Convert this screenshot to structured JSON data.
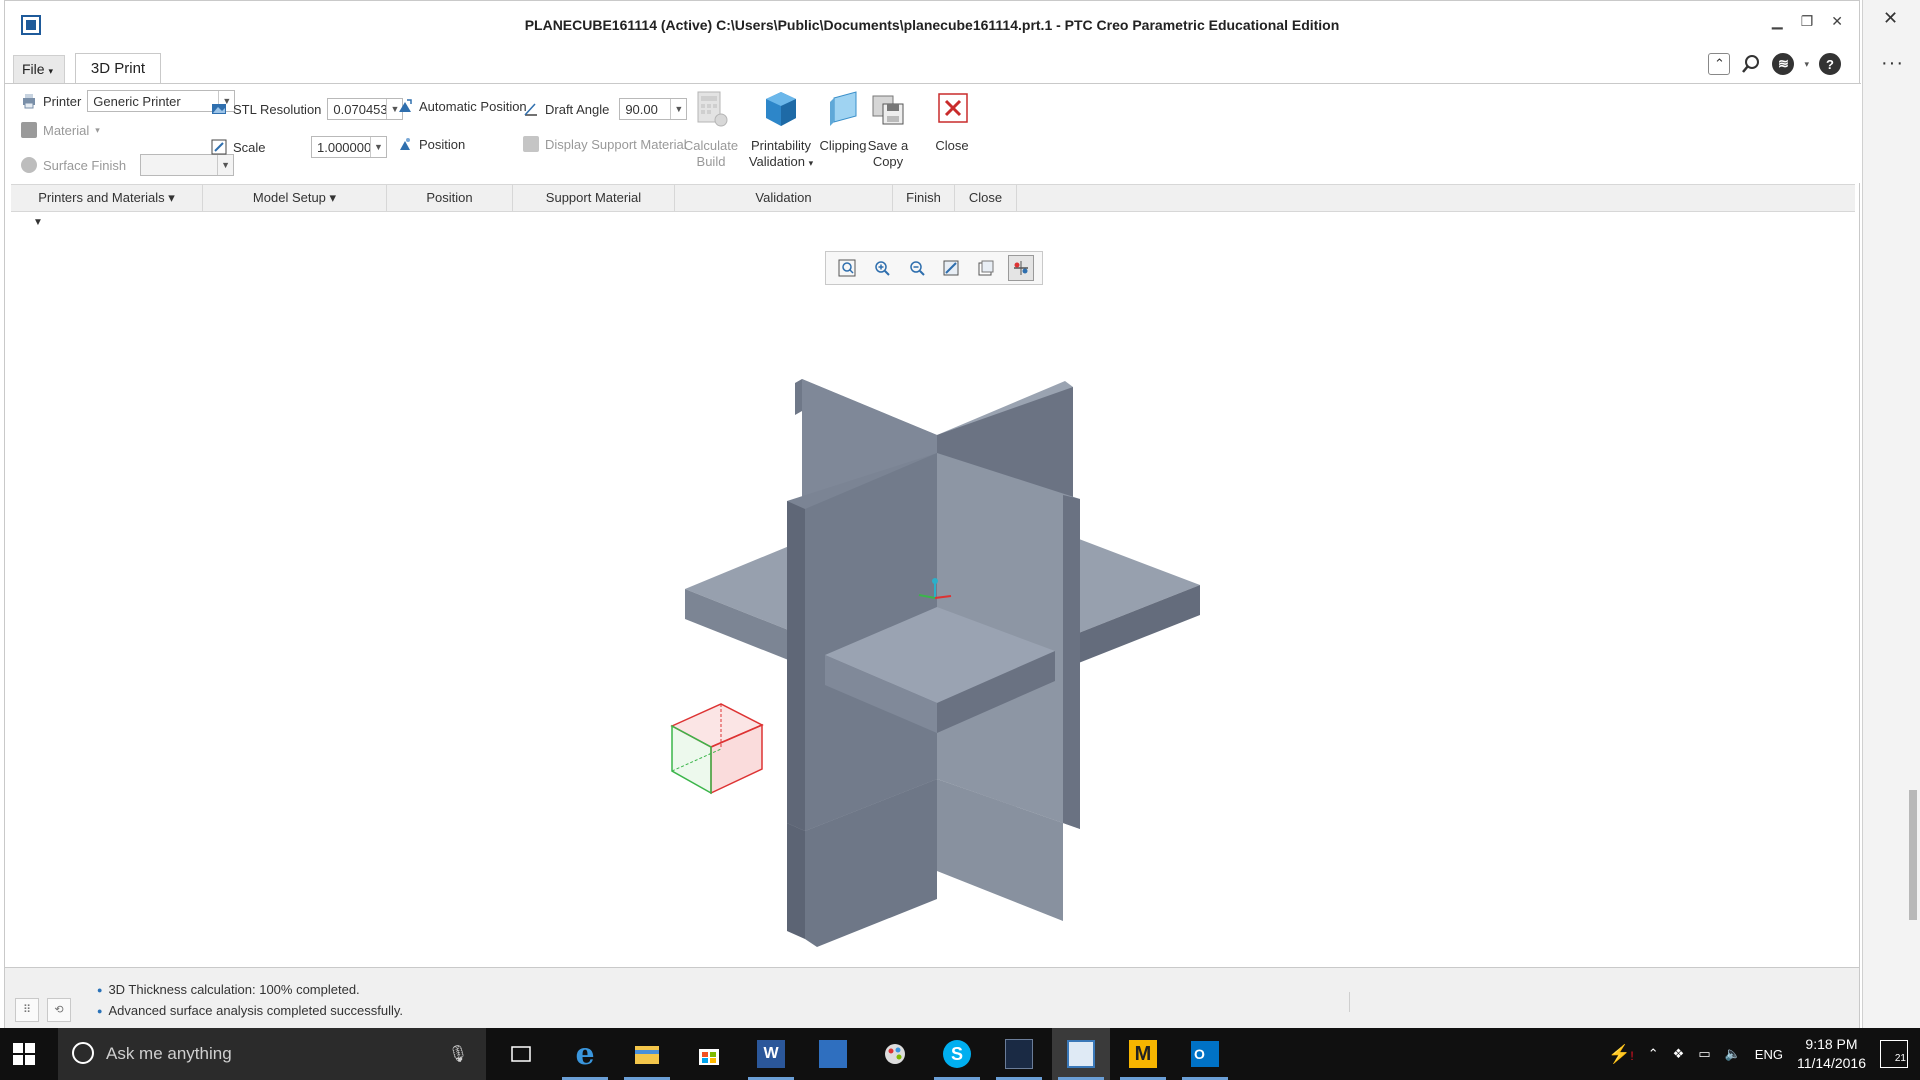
{
  "window": {
    "title": "PLANECUBE161114 (Active) C:\\Users\\Public\\Documents\\planecube161114.prt.1 - PTC Creo Parametric Educational Edition"
  },
  "tabs": {
    "file": "File",
    "active": "3D Print"
  },
  "ribbon": {
    "printer_label": "Printer",
    "printer_value": "Generic Printer",
    "material_label": "Material",
    "surface_finish_label": "Surface Finish",
    "stl_label": "STL Resolution",
    "stl_value": "0.070453",
    "scale_label": "Scale",
    "scale_value": "1.000000",
    "auto_position": "Automatic Position",
    "position": "Position",
    "draft_label": "Draft Angle",
    "draft_value": "90.00",
    "display_support": "Display Support Material",
    "calculate_build": [
      "Calculate",
      "Build"
    ],
    "printability": [
      "Printability",
      "Validation"
    ],
    "clipping": "Clipping",
    "save_copy": [
      "Save a",
      "Copy"
    ],
    "close": "Close"
  },
  "groups": [
    {
      "label": "Printers and Materials ▾",
      "width": 192
    },
    {
      "label": "Model Setup ▾",
      "width": 184
    },
    {
      "label": "Position",
      "width": 126
    },
    {
      "label": "Support Material",
      "width": 162
    },
    {
      "label": "Validation",
      "width": 218
    },
    {
      "label": "Finish",
      "width": 62
    },
    {
      "label": "Close",
      "width": 62
    }
  ],
  "status": {
    "messages": [
      "3D Thickness calculation: 100% completed.",
      "Advanced surface analysis completed successfully."
    ]
  },
  "taskbar": {
    "search_placeholder": "Ask me anything",
    "language": "ENG",
    "time": "9:18 PM",
    "date": "11/14/2016",
    "notifications": "21"
  }
}
